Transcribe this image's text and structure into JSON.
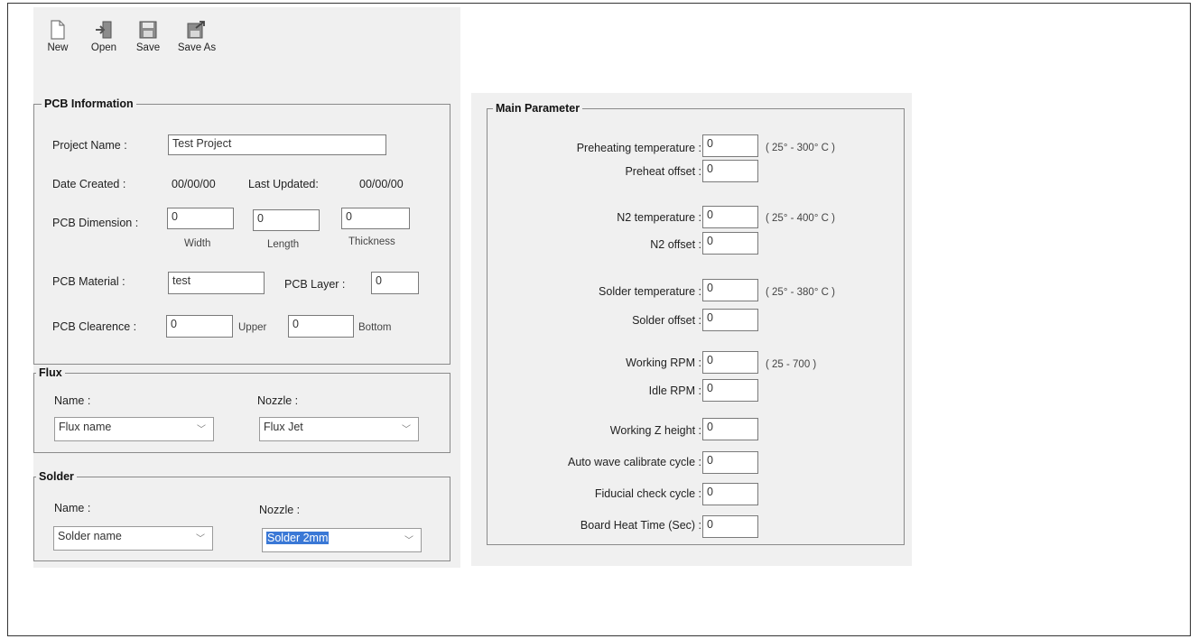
{
  "toolbar": {
    "new_label": "New",
    "open_label": "Open",
    "save_label": "Save",
    "save_as_label": "Save As"
  },
  "pcb_info": {
    "title": "PCB Information",
    "project_name_label": "Project Name :",
    "project_name_value": "Test Project",
    "date_created_label": "Date Created :",
    "date_created_value": "00/00/00",
    "last_updated_label": "Last Updated:",
    "last_updated_value": "00/00/00",
    "dimension_label": "PCB Dimension :",
    "width_value": "0",
    "length_value": "0",
    "thickness_value": "0",
    "width_caption": "Width",
    "length_caption": "Length",
    "thickness_caption": "Thickness",
    "material_label": "PCB Material :",
    "material_value": "test",
    "layer_label": "PCB Layer :",
    "layer_value": "0",
    "clearence_label": "PCB Clearence :",
    "upper_value": "0",
    "upper_caption": "Upper",
    "bottom_value": "0",
    "bottom_caption": "Bottom"
  },
  "flux": {
    "title": "Flux",
    "name_label": "Name :",
    "nozzle_label": "Nozzle :",
    "name_selected": "Flux name",
    "nozzle_selected": "Flux Jet"
  },
  "solder": {
    "title": "Solder",
    "name_label": "Name :",
    "nozzle_label": "Nozzle :",
    "name_selected": "Solder name",
    "nozzle_selected": "Solder 2mm"
  },
  "main_param": {
    "title": "Main Parameter",
    "preheat_temp_label": "Preheating temperature :",
    "preheat_temp_value": "0",
    "preheat_temp_range": "( 25° - 300° C )",
    "preheat_offset_label": "Preheat offset :",
    "preheat_offset_value": "0",
    "n2_temp_label": "N2 temperature :",
    "n2_temp_value": "0",
    "n2_temp_range": "( 25° - 400° C )",
    "n2_offset_label": "N2 offset :",
    "n2_offset_value": "0",
    "solder_temp_label": "Solder temperature :",
    "solder_temp_value": "0",
    "solder_temp_range": "( 25° - 380° C )",
    "solder_offset_label": "Solder offset :",
    "solder_offset_value": "0",
    "working_rpm_label": "Working RPM :",
    "working_rpm_value": "0",
    "working_rpm_range": "( 25 - 700 )",
    "idle_rpm_label": "Idle RPM :",
    "idle_rpm_value": "0",
    "working_z_label": "Working Z height :",
    "working_z_value": "0",
    "auto_wave_label": "Auto wave calibrate cycle :",
    "auto_wave_value": "0",
    "fiducial_label": "Fiducial check cycle :",
    "fiducial_value": "0",
    "board_heat_label": "Board Heat Time (Sec) :",
    "board_heat_value": "0"
  },
  "icons": {
    "new": "new-file-icon",
    "open": "open-file-icon",
    "save": "save-icon",
    "save_as": "save-as-icon"
  }
}
